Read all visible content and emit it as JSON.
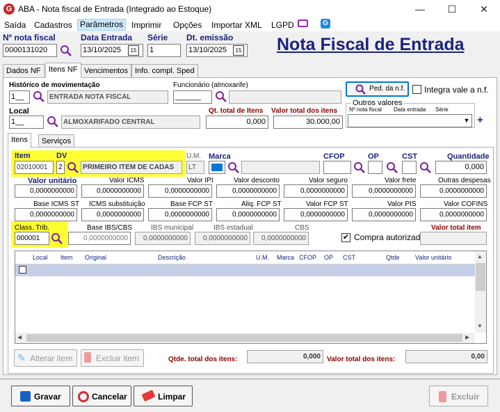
{
  "window": {
    "title": "ABA - Nota fiscal de Entrada (Integrado ao Estoque)",
    "controls": [
      "—",
      "☐",
      "✕"
    ]
  },
  "menu": [
    "Saída",
    "Cadastros",
    "Parâmetros",
    "Imprimir",
    "Opções",
    "Importar XML",
    "LGPD"
  ],
  "header": {
    "nota_label": "Nº nota fiscal",
    "nota_value": "0000131020",
    "data_entrada_label": "Data Entrada",
    "data_entrada_value": "13/10/2025",
    "serie_label": "Série",
    "serie_value": "1",
    "dt_emissao_label": "Dt. emissão",
    "dt_emissao_value": "13/10/2025",
    "big_title": "Nota Fiscal de Entrada",
    "calendar_glyph": "15"
  },
  "tabs": [
    "Dados NF",
    "Itens NF",
    "Vencimentos",
    "Info. compl. Sped"
  ],
  "itensnf": {
    "hist_label": "Histórico de movimentação",
    "hist_code": "1__",
    "hist_desc": "ENTRADA NOTA FISCAL",
    "func_label": "Funcionário (almoxarife)",
    "func_code": "______",
    "ped_button": "Ped. da n.f.",
    "integra_label": "Integra vale a n.f.",
    "local_label": "Local",
    "local_code": "1__",
    "local_desc": "ALMOXARIFADO CENTRAL",
    "qt_total_label": "Qt. total de Itens",
    "qt_total_value": "0,000",
    "valor_total_label": "Valor total dos itens",
    "valor_total_value": "30.000,00",
    "outros_label": "Outros valores",
    "outros_headers": [
      "Nº nota fiscal",
      "Data entrada",
      "Série"
    ]
  },
  "subtabs": [
    "Itens",
    "Serviços"
  ],
  "item": {
    "item_label": "Item",
    "item_value": "02010001",
    "dv_label": "DV",
    "dv_value": "2",
    "desc_value": "PRIMEIRO ITEM DE CADAS",
    "um_label": "U.M.",
    "um_value": "LT",
    "marca_label": "Marca",
    "cfop_label": "CFOP",
    "op_label": "OP",
    "cst_label": "CST",
    "quantidade_label": "Quantidade",
    "quantidade_value": "0,000"
  },
  "row1": {
    "labels": [
      "Valor unitário",
      "Valor ICMS",
      "Valor IPI",
      "Valor desconto",
      "Valor seguro",
      "Valor frete",
      "Outras despesas"
    ],
    "values": [
      "0,0000000000",
      "0,0000000000",
      "0,0000000000",
      "0,0000000000",
      "0,0000000000",
      "0,0000000000",
      "0,0000000000"
    ]
  },
  "row2": {
    "labels": [
      "Base ICMS ST",
      "ICMS substituição",
      "Base FCP ST",
      "Aliq. FCP ST",
      "Valor FCP ST",
      "Valor PIS",
      "Valor COFINS"
    ],
    "values": [
      "0,0000000000",
      "0,0000000000",
      "0,0000000000",
      "0,0000000000",
      "0,0000000000",
      "0,0000000000",
      "0,0000000000"
    ]
  },
  "row3": {
    "class_label": "Class. Trib.",
    "class_value": "000001",
    "labels": [
      "Base IBS/CBS",
      "IBS municipal",
      "IBS estadual",
      "CBS"
    ],
    "values": [
      "0,0000000000",
      "0,0000000000",
      "0,0000000000",
      "0,0000000000"
    ],
    "compra_label": "Compra autorizada",
    "valor_total_item_label": "Valor total item"
  },
  "grid": {
    "headers": [
      "Local",
      "Item",
      "Original",
      "Descrição",
      "U.M.",
      "Marca",
      "CFOP",
      "OP",
      "CST",
      "Qtde",
      "Valor unitário"
    ]
  },
  "bottom": {
    "alterar": "Alterar item",
    "excluir_item": "Excluir item",
    "qtde_total_label": "Qtde. total dos itens:",
    "qtde_total_value": "0,000",
    "valor_total_label": "Valor total dos itens:",
    "valor_total_value": "0,00"
  },
  "footer": {
    "gravar": "Gravar",
    "cancelar": "Cancelar",
    "limpar": "Limpar",
    "excluir": "Excluir"
  }
}
